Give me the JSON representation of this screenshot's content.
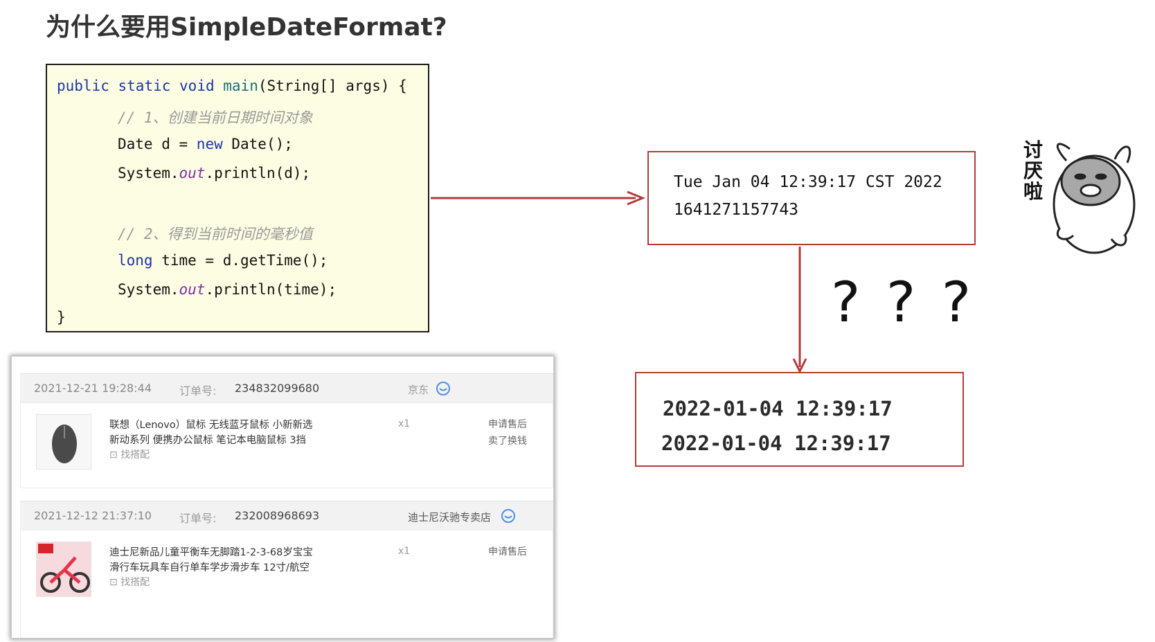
{
  "title": "为什么要用SimpleDateFormat?",
  "code": {
    "l1": {
      "kw1": "public",
      "kw2": "static",
      "kw3": "void",
      "fn": "main",
      "rest": "(String[] args) {"
    },
    "l2": "// 1、创建当前日期时间对象",
    "l3": {
      "pre": "Date d = ",
      "kw": "new",
      "post": " Date();"
    },
    "l4": {
      "pre": "System.",
      "fld": "out",
      "post": ".println(d);"
    },
    "l5": "// 2、得到当前时间的毫秒值",
    "l6": {
      "kw": "long",
      "post": " time = d.getTime();"
    },
    "l7": {
      "pre": "System.",
      "fld": "out",
      "post": ".println(time);"
    },
    "l8": "}"
  },
  "output": {
    "line1": "Tue Jan 04 12:39:17 CST 2022",
    "line2": "1641271157743"
  },
  "formatted": {
    "line1": "2022-01-04 12:39:17",
    "line2": "2022-01-04 12:39:17"
  },
  "question_marks": "? ? ?",
  "sticker_text": "讨厌啦",
  "orders": [
    {
      "date": "2021-12-21 19:28:44",
      "order_label": "订单号:",
      "order_number": "234832099680",
      "shop": "京东",
      "product_line1": "联想（Lenovo）鼠标 无线蓝牙鼠标 小新新选",
      "product_line2": "新动系列 便携办公鼠标 笔记本电脑鼠标 3挡",
      "find_label": "找搭配",
      "qty": "x1",
      "action1": "申请售后",
      "action2": "卖了换钱"
    },
    {
      "date": "2021-12-12 21:37:10",
      "order_label": "订单号:",
      "order_number": "232008968693",
      "shop": "迪士尼沃驰专卖店",
      "product_line1": "迪士尼新品儿童平衡车无脚踏1-2-3-68岁宝宝",
      "product_line2": "滑行车玩具车自行单车学步滑步车 12寸/航空",
      "find_label": "找搭配",
      "qty": "x1",
      "action1": "申请售后"
    }
  ],
  "colors": {
    "arrow": "#b33a3a",
    "code_bg": "#fdfde3",
    "keyword": "#1b33a6",
    "underline": "#e02020"
  }
}
